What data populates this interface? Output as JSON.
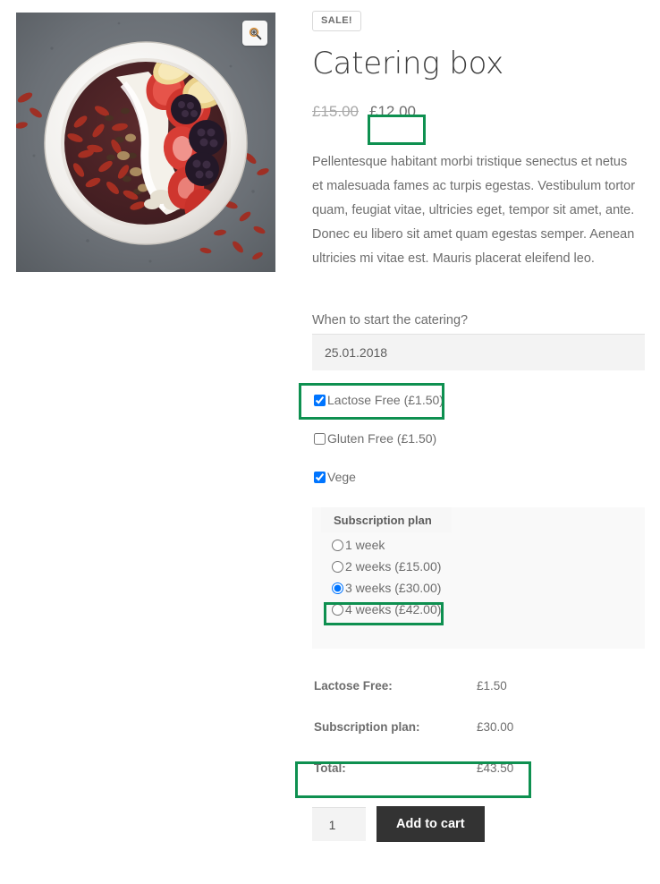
{
  "gallery": {
    "zoom_icon": "magnifier-zoom-in-icon",
    "image_alt": "acai smoothie bowl with strawberries, banana, blackberries, goji berries and coconut on slate"
  },
  "summary": {
    "sale_badge": "SALE!",
    "title": "Catering box",
    "price_old": "£15.00",
    "price_new": "£12.00",
    "description": "Pellentesque habitant morbi tristique senectus et netus et malesuada fames ac turpis egestas. Vestibulum tortor quam, feugiat vitae, ultricies eget, tempor sit amet, ante. Donec eu libero sit amet quam egestas semper. Aenean ultricies mi vitae est. Mauris placerat eleifend leo."
  },
  "date_field": {
    "label": "When to start the catering?",
    "value": "25.01.2018",
    "placeholder": "25.01.2018"
  },
  "options": [
    {
      "label": "Lactose Free (£1.50)",
      "checked": true
    },
    {
      "label": "Gluten Free (£1.50)",
      "checked": false
    },
    {
      "label": "Vege",
      "checked": true
    }
  ],
  "plan": {
    "legend": "Subscription plan",
    "choices": [
      {
        "label": "1 week",
        "selected": false
      },
      {
        "label": "2 weeks (£15.00)",
        "selected": false
      },
      {
        "label": "3 weeks (£30.00)",
        "selected": true
      },
      {
        "label": "4 weeks (£42.00)",
        "selected": false
      }
    ]
  },
  "totals": [
    {
      "label": "Lactose Free:",
      "value": "£1.50"
    },
    {
      "label": "Subscription plan:",
      "value": "£30.00"
    },
    {
      "label": "Total:",
      "value": "£43.50"
    }
  ],
  "cart": {
    "quantity": "1",
    "add_label": "Add to cart"
  },
  "colors": {
    "highlight": "#0e9050",
    "button": "#333333",
    "text": "#6d6d6d",
    "title": "#3d3d3d"
  }
}
